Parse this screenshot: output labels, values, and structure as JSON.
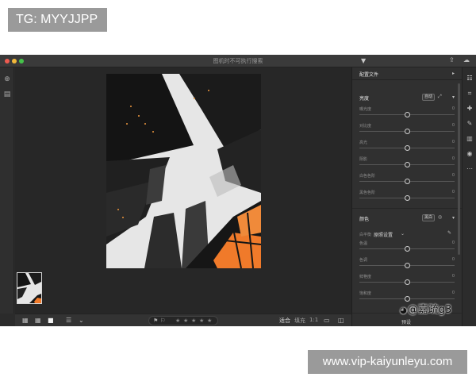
{
  "overlay": {
    "top_tag": "TG: MYYJJPP",
    "bottom_tag": "www.vip-kaiyunleyu.com",
    "watermark": "@嘉疏g3"
  },
  "window": {
    "title": "图机时不可执行搜索"
  },
  "panel": {
    "header": "配置文件",
    "light": {
      "title": "亮度",
      "auto": "自动",
      "sliders": [
        {
          "label": "曝光度",
          "value": "0"
        },
        {
          "label": "对比度",
          "value": "0"
        },
        {
          "label": "高光",
          "value": "0"
        },
        {
          "label": "阴影",
          "value": "0"
        },
        {
          "label": "白色色阶",
          "value": "0"
        },
        {
          "label": "黑色色阶",
          "value": "0"
        }
      ]
    },
    "color": {
      "title": "颜色",
      "bw": "黑白",
      "wb_label": "白平衡",
      "wb_value": "原照设置",
      "sliders": [
        {
          "label": "色温",
          "value": "0"
        },
        {
          "label": "色调",
          "value": "0"
        },
        {
          "label": "鲜艳度",
          "value": "0"
        },
        {
          "label": "饱和度",
          "value": "0"
        }
      ]
    },
    "preset": "预设"
  },
  "bottombar": {
    "zoom_fit": "适合",
    "zoom_fill": "填充",
    "zoom_ratio": "1:1",
    "rating_stars": 5
  },
  "colors": {
    "app_bg": "#2b2b2b",
    "panel_bg": "#303030",
    "accent_orange": "#f07a2a",
    "tag_gray": "#9a9a9a"
  }
}
